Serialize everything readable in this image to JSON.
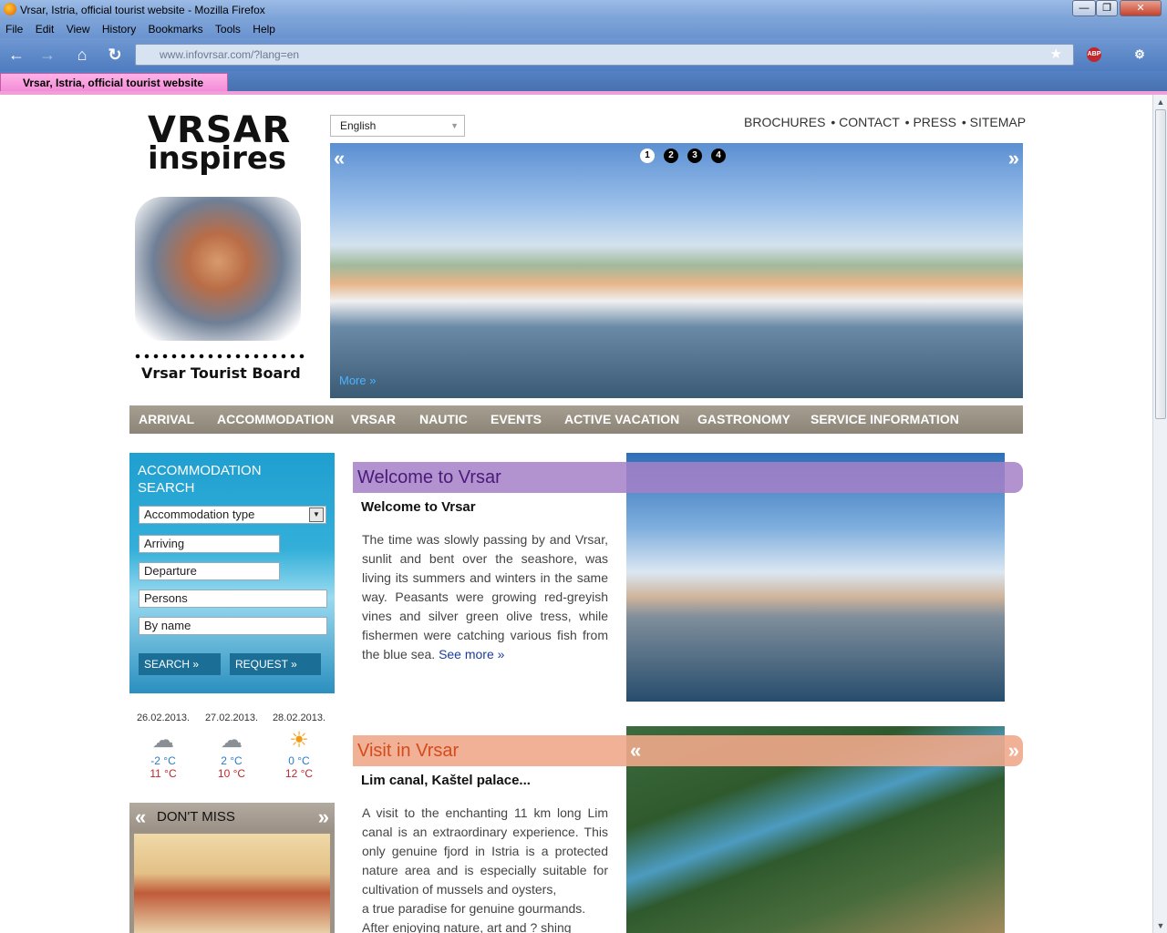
{
  "window": {
    "title": "Vrsar, Istria, official tourist website - Mozilla Firefox"
  },
  "menu": [
    "File",
    "Edit",
    "View",
    "History",
    "Bookmarks",
    "Tools",
    "Help"
  ],
  "url": "www.infovrsar.com/?lang=en",
  "tab": {
    "label": "Vrsar, Istria, official tourist website"
  },
  "site": {
    "logo_line1": "VRSAR",
    "logo_line2": "inspires",
    "board": "Vrsar Tourist Board",
    "language": "English",
    "toplinks": [
      "BROCHURES",
      "CONTACT",
      "PRESS",
      "SITEMAP"
    ],
    "hero": {
      "bullets": [
        "1",
        "2",
        "3",
        "4"
      ],
      "more": "More »"
    },
    "nav": [
      "ARRIVAL",
      "ACCOMMODATION",
      "VRSAR",
      "NAUTIC",
      "EVENTS",
      "ACTIVE VACATION",
      "GASTRONOMY",
      "SERVICE INFORMATION"
    ]
  },
  "search": {
    "title_line1": "ACCOMMODATION",
    "title_line2": "SEARCH",
    "type": "Accommodation type",
    "arriving": "Arriving",
    "departure": "Departure",
    "persons": "Persons",
    "byname": "By name",
    "search_btn": "SEARCH »",
    "request_btn": "REQUEST »"
  },
  "weather": [
    {
      "date": "26.02.2013.",
      "icon": "rain-cloud-icon",
      "lo": "-2 °C",
      "hi": "11 °C"
    },
    {
      "date": "27.02.2013.",
      "icon": "rain-cloud-icon",
      "lo": "2 °C",
      "hi": "10 °C"
    },
    {
      "date": "28.02.2013.",
      "icon": "sun-icon",
      "lo": "0 °C",
      "hi": "12 °C"
    }
  ],
  "dontmiss": {
    "label": "DON'T MISS"
  },
  "welcome": {
    "title": "Welcome to Vrsar",
    "subtitle": "Welcome to Vrsar",
    "text": "The time was slowly passing by and Vrsar, sunlit and bent over the seashore, was living its summers and winters in the same way. Peasants were growing red-greyish vines and silver green olive tress, while fishermen were catching various fish from the blue sea.",
    "link": "See more »"
  },
  "visit": {
    "title": "Visit in Vrsar",
    "subtitle": "Lim canal, Kaštel palace...",
    "text1": "A visit to the enchanting 11 km long Lim canal is an extraordinary experience. This only genuine fjord in Istria is a protected nature area and is especially suitable for cultivation of mussels and oysters,",
    "text2": "a true paradise for genuine gourmands.",
    "text3": "After enjoying nature, art and ? shing"
  },
  "colors": {
    "welcome_bar": "#a680c7",
    "visit_bar": "#efa98b",
    "welcome_text": "#4a1a7a",
    "visit_text": "#d44b1c"
  }
}
